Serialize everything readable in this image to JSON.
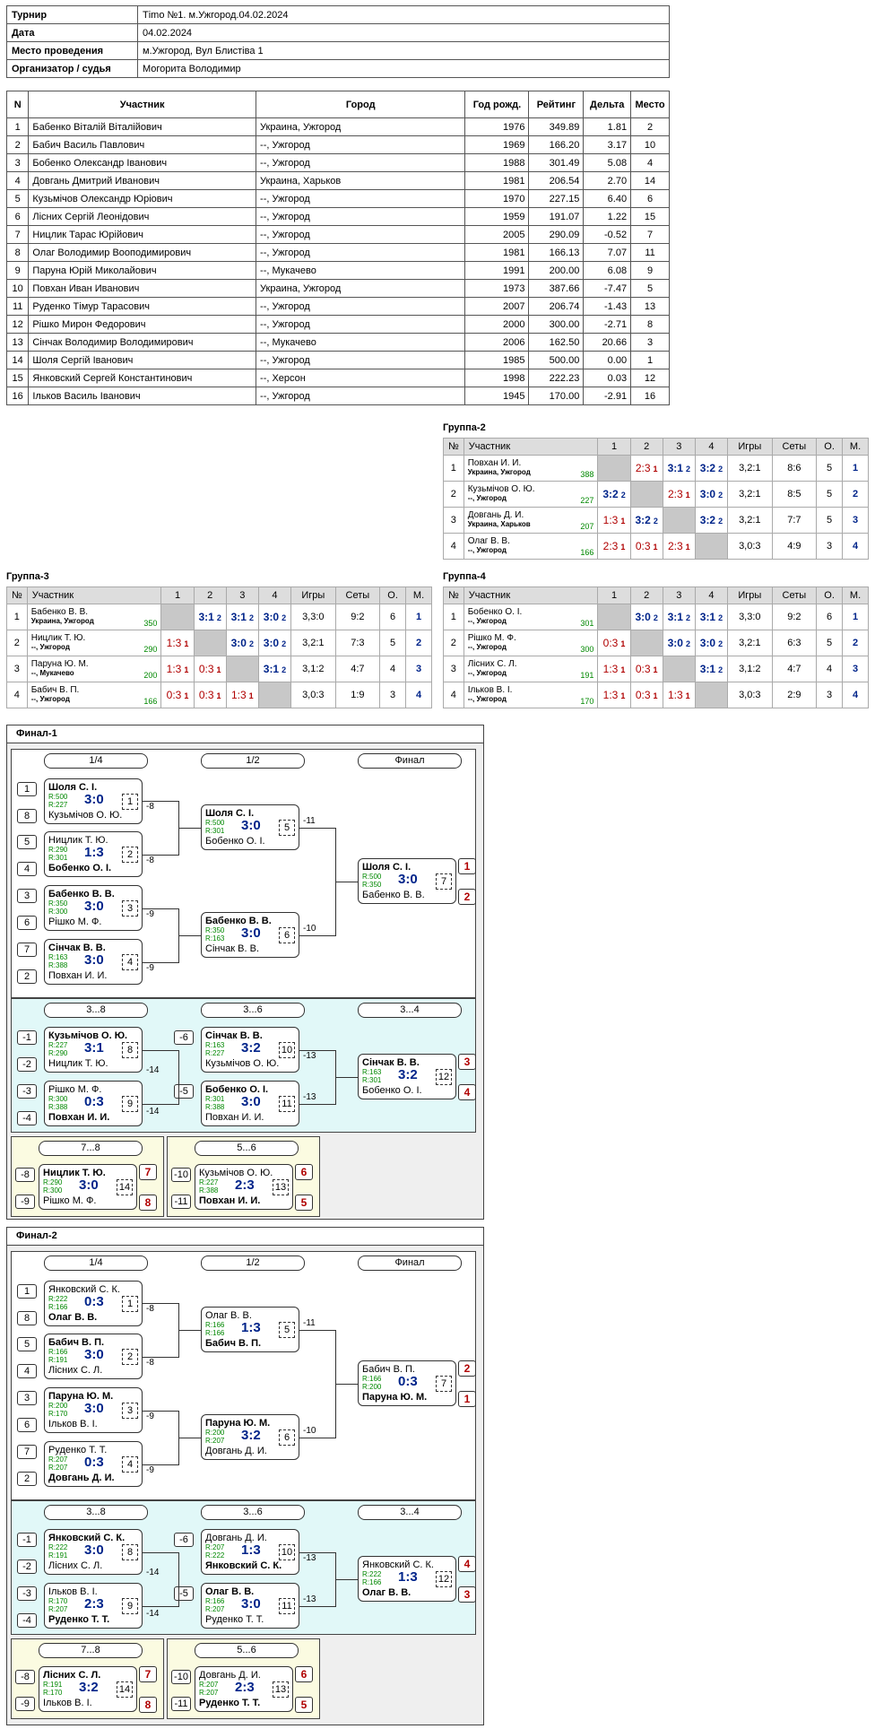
{
  "info": {
    "rows": [
      [
        "Турнир",
        "Тimo №1. м.Ужгород.04.02.2024"
      ],
      [
        "Дата",
        "04.02.2024"
      ],
      [
        "Место проведения",
        "м.Ужгород, Вул Блистіва 1"
      ],
      [
        "Организатор / судья",
        "Могорита Володимир"
      ]
    ]
  },
  "players": {
    "headers": [
      "N",
      "Участник",
      "Город",
      "Год рожд.",
      "Рейтинг",
      "Дельта",
      "Место"
    ],
    "rows": [
      [
        "1",
        "Бабенко Віталій Віталійович",
        "Украина, Ужгород",
        "1976",
        "349.89",
        "1.81",
        "2"
      ],
      [
        "2",
        "Бабич Василь Павлович",
        "--, Ужгород",
        "1969",
        "166.20",
        "3.17",
        "10"
      ],
      [
        "3",
        "Бобенко Олександр Іванович",
        "--, Ужгород",
        "1988",
        "301.49",
        "5.08",
        "4"
      ],
      [
        "4",
        "Довгань Дмитрий Иванович",
        "Украина, Харьков",
        "1981",
        "206.54",
        "2.70",
        "14"
      ],
      [
        "5",
        "Кузьмічов Олександр Юріович",
        "--, Ужгород",
        "1970",
        "227.15",
        "6.40",
        "6"
      ],
      [
        "6",
        "Лісних Сергій Леонідович",
        "--, Ужгород",
        "1959",
        "191.07",
        "1.22",
        "15"
      ],
      [
        "7",
        "Ницлик Тарас Юрійович",
        "--, Ужгород",
        "2005",
        "290.09",
        "-0.52",
        "7"
      ],
      [
        "8",
        "Олаг Володимир Вооподимирович",
        "--, Ужгород",
        "1981",
        "166.13",
        "7.07",
        "11"
      ],
      [
        "9",
        "Паруна Юрій Миколайович",
        "--, Мукачево",
        "1991",
        "200.00",
        "6.08",
        "9"
      ],
      [
        "10",
        "Повхан Иван Иванович",
        "Украина, Ужгород",
        "1973",
        "387.66",
        "-7.47",
        "5"
      ],
      [
        "11",
        "Руденко Тімур Тарасович",
        "--, Ужгород",
        "2007",
        "206.74",
        "-1.43",
        "13"
      ],
      [
        "12",
        "Рішко Мирон Федорович",
        "--, Ужгород",
        "2000",
        "300.00",
        "-2.71",
        "8"
      ],
      [
        "13",
        "Сінчак Володимир Володимирович",
        "--, Мукачево",
        "2006",
        "162.50",
        "20.66",
        "3"
      ],
      [
        "14",
        "Шоля Сергій Іванович",
        "--, Ужгород",
        "1985",
        "500.00",
        "0.00",
        "1"
      ],
      [
        "15",
        "Янковский Сергей Константинович",
        "--, Херсон",
        "1998",
        "222.23",
        "0.03",
        "12"
      ],
      [
        "16",
        "Ільков Василь Іванович",
        "--, Ужгород",
        "1945",
        "170.00",
        "-2.91",
        "16"
      ]
    ]
  },
  "group_headers": [
    "№",
    "Участник",
    "1",
    "2",
    "3",
    "4",
    "Игры",
    "Сеты",
    "О.",
    "М."
  ],
  "groups": [
    {
      "title": "Группа-2",
      "rows": [
        {
          "n": "1",
          "name": "Повхан И. И.",
          "city": "Украина, Ужгород",
          "rating": "388",
          "cells": [
            null,
            [
              "2:3",
              "1"
            ],
            [
              "3:1",
              "2"
            ],
            [
              "3:2",
              "2"
            ]
          ],
          "games": "3,2:1",
          "sets": "8:6",
          "pts": "5",
          "place": "1"
        },
        {
          "n": "2",
          "name": "Кузьмічов О. Ю.",
          "city": "--, Ужгород",
          "rating": "227",
          "cells": [
            [
              "3:2",
              "2"
            ],
            null,
            [
              "2:3",
              "1"
            ],
            [
              "3:0",
              "2"
            ]
          ],
          "games": "3,2:1",
          "sets": "8:5",
          "pts": "5",
          "place": "2"
        },
        {
          "n": "3",
          "name": "Довгань Д. И.",
          "city": "Украина, Харьков",
          "rating": "207",
          "cells": [
            [
              "1:3",
              "1"
            ],
            [
              "3:2",
              "2"
            ],
            null,
            [
              "3:2",
              "2"
            ]
          ],
          "games": "3,2:1",
          "sets": "7:7",
          "pts": "5",
          "place": "3"
        },
        {
          "n": "4",
          "name": "Олаг В. В.",
          "city": "--, Ужгород",
          "rating": "166",
          "cells": [
            [
              "2:3",
              "1"
            ],
            [
              "0:3",
              "1"
            ],
            [
              "2:3",
              "1"
            ],
            null
          ],
          "games": "3,0:3",
          "sets": "4:9",
          "pts": "3",
          "place": "4"
        }
      ]
    },
    {
      "title": "Группа-3",
      "rows": [
        {
          "n": "1",
          "name": "Бабенко В. В.",
          "city": "Украина, Ужгород",
          "rating": "350",
          "cells": [
            null,
            [
              "3:1",
              "2"
            ],
            [
              "3:1",
              "2"
            ],
            [
              "3:0",
              "2"
            ]
          ],
          "games": "3,3:0",
          "sets": "9:2",
          "pts": "6",
          "place": "1"
        },
        {
          "n": "2",
          "name": "Ницлик Т. Ю.",
          "city": "--, Ужгород",
          "rating": "290",
          "cells": [
            [
              "1:3",
              "1"
            ],
            null,
            [
              "3:0",
              "2"
            ],
            [
              "3:0",
              "2"
            ]
          ],
          "games": "3,2:1",
          "sets": "7:3",
          "pts": "5",
          "place": "2"
        },
        {
          "n": "3",
          "name": "Паруна Ю. М.",
          "city": "--, Мукачево",
          "rating": "200",
          "cells": [
            [
              "1:3",
              "1"
            ],
            [
              "0:3",
              "1"
            ],
            null,
            [
              "3:1",
              "2"
            ]
          ],
          "games": "3,1:2",
          "sets": "4:7",
          "pts": "4",
          "place": "3"
        },
        {
          "n": "4",
          "name": "Бабич В. П.",
          "city": "--, Ужгород",
          "rating": "166",
          "cells": [
            [
              "0:3",
              "1"
            ],
            [
              "0:3",
              "1"
            ],
            [
              "1:3",
              "1"
            ],
            null
          ],
          "games": "3,0:3",
          "sets": "1:9",
          "pts": "3",
          "place": "4"
        }
      ]
    },
    {
      "title": "Группа-4",
      "rows": [
        {
          "n": "1",
          "name": "Бобенко О. І.",
          "city": "--, Ужгород",
          "rating": "301",
          "cells": [
            null,
            [
              "3:0",
              "2"
            ],
            [
              "3:1",
              "2"
            ],
            [
              "3:1",
              "2"
            ]
          ],
          "games": "3,3:0",
          "sets": "9:2",
          "pts": "6",
          "place": "1"
        },
        {
          "n": "2",
          "name": "Рішко М. Ф.",
          "city": "--, Ужгород",
          "rating": "300",
          "cells": [
            [
              "0:3",
              "1"
            ],
            null,
            [
              "3:0",
              "2"
            ],
            [
              "3:0",
              "2"
            ]
          ],
          "games": "3,2:1",
          "sets": "6:3",
          "pts": "5",
          "place": "2"
        },
        {
          "n": "3",
          "name": "Лісних С. Л.",
          "city": "--, Ужгород",
          "rating": "191",
          "cells": [
            [
              "1:3",
              "1"
            ],
            [
              "0:3",
              "1"
            ],
            null,
            [
              "3:1",
              "2"
            ]
          ],
          "games": "3,1:2",
          "sets": "4:7",
          "pts": "4",
          "place": "3"
        },
        {
          "n": "4",
          "name": "Ільков В. І.",
          "city": "--, Ужгород",
          "rating": "170",
          "cells": [
            [
              "1:3",
              "1"
            ],
            [
              "0:3",
              "1"
            ],
            [
              "1:3",
              "1"
            ],
            null
          ],
          "games": "3,0:3",
          "sets": "2:9",
          "pts": "3",
          "place": "4"
        }
      ]
    }
  ],
  "finals": [
    {
      "title": "Финал-1",
      "rounds": [
        "1/4",
        "1/2",
        "Финал",
        "3...8",
        "3...6",
        "3...4",
        "7...8",
        "5...6"
      ],
      "seeds": [
        "1",
        "8",
        "5",
        "4",
        "3",
        "6",
        "7",
        "2",
        "-1",
        "-2",
        "-3",
        "-4",
        "-6",
        "-5",
        "-8",
        "-9",
        "-10",
        "-11"
      ],
      "results": [
        "1",
        "2",
        "3",
        "4",
        "7",
        "8",
        "6",
        "5"
      ],
      "links": [
        "-8",
        "-8",
        "-9",
        "-9",
        "-11",
        "-10",
        "-14",
        "-14",
        "-13",
        "-13"
      ],
      "matches": [
        {
          "p1": "Шоля С. І.",
          "r1": "R:500",
          "p2": "Кузьмічов О. Ю.",
          "r2": "R:227",
          "s": "3:0",
          "n": "1",
          "w": 1
        },
        {
          "p1": "Ницлик Т. Ю.",
          "r1": "R:290",
          "p2": "Бобенко О. І.",
          "r2": "R:301",
          "s": "1:3",
          "n": "2",
          "w": 2
        },
        {
          "p1": "Бабенко В. В.",
          "r1": "R:350",
          "p2": "Рішко М. Ф.",
          "r2": "R:300",
          "s": "3:0",
          "n": "3",
          "w": 1
        },
        {
          "p1": "Сінчак В. В.",
          "r1": "R:163",
          "p2": "Повхан И. И.",
          "r2": "R:388",
          "s": "3:0",
          "n": "4",
          "w": 1
        },
        {
          "p1": "Шоля С. І.",
          "r1": "R:500",
          "p2": "Бобенко О. І.",
          "r2": "R:301",
          "s": "3:0",
          "n": "5",
          "w": 1
        },
        {
          "p1": "Бабенко В. В.",
          "r1": "R:350",
          "p2": "Сінчак В. В.",
          "r2": "R:163",
          "s": "3:0",
          "n": "6",
          "w": 1
        },
        {
          "p1": "Шоля С. І.",
          "r1": "R:500",
          "p2": "Бабенко В. В.",
          "r2": "R:350",
          "s": "3:0",
          "n": "7",
          "w": 1
        },
        {
          "p1": "Кузьмічов О. Ю.",
          "r1": "R:227",
          "p2": "Ницлик Т. Ю.",
          "r2": "R:290",
          "s": "3:1",
          "n": "8",
          "w": 1
        },
        {
          "p1": "Рішко М. Ф.",
          "r1": "R:300",
          "p2": "Повхан И. И.",
          "r2": "R:388",
          "s": "0:3",
          "n": "9",
          "w": 2
        },
        {
          "p1": "Сінчак В. В.",
          "r1": "R:163",
          "p2": "Кузьмічов О. Ю.",
          "r2": "R:227",
          "s": "3:2",
          "n": "10",
          "w": 1
        },
        {
          "p1": "Бобенко О. І.",
          "r1": "R:301",
          "p2": "Повхан И. И.",
          "r2": "R:388",
          "s": "3:0",
          "n": "11",
          "w": 1
        },
        {
          "p1": "Сінчак В. В.",
          "r1": "R:163",
          "p2": "Бобенко О. І.",
          "r2": "R:301",
          "s": "3:2",
          "n": "12",
          "w": 1
        },
        {
          "p1": "Ницлик Т. Ю.",
          "r1": "R:290",
          "p2": "Рішко М. Ф.",
          "r2": "R:300",
          "s": "3:0",
          "n": "14",
          "w": 1
        },
        {
          "p1": "Кузьмічов О. Ю.",
          "r1": "R:227",
          "p2": "Повхан И. И.",
          "r2": "R:388",
          "s": "2:3",
          "n": "13",
          "w": 2
        }
      ]
    },
    {
      "title": "Финал-2",
      "rounds": [
        "1/4",
        "1/2",
        "Финал",
        "3...8",
        "3...6",
        "3...4",
        "7...8",
        "5...6"
      ],
      "seeds": [
        "1",
        "8",
        "5",
        "4",
        "3",
        "6",
        "7",
        "2",
        "-1",
        "-2",
        "-3",
        "-4",
        "-6",
        "-5",
        "-8",
        "-9",
        "-10",
        "-11"
      ],
      "results": [
        "2",
        "1",
        "4",
        "3",
        "7",
        "8",
        "6",
        "5"
      ],
      "links": [
        "-8",
        "-8",
        "-9",
        "-9",
        "-11",
        "-10",
        "-14",
        "-14",
        "-13",
        "-13"
      ],
      "matches": [
        {
          "p1": "Янковский С. К.",
          "r1": "R:222",
          "p2": "Олаг В. В.",
          "r2": "R:166",
          "s": "0:3",
          "n": "1",
          "w": 2
        },
        {
          "p1": "Бабич В. П.",
          "r1": "R:166",
          "p2": "Лісних С. Л.",
          "r2": "R:191",
          "s": "3:0",
          "n": "2",
          "w": 1
        },
        {
          "p1": "Паруна Ю. М.",
          "r1": "R:200",
          "p2": "Ільков В. І.",
          "r2": "R:170",
          "s": "3:0",
          "n": "3",
          "w": 1
        },
        {
          "p1": "Руденко Т. Т.",
          "r1": "R:207",
          "p2": "Довгань Д. И.",
          "r2": "R:207",
          "s": "0:3",
          "n": "4",
          "w": 2
        },
        {
          "p1": "Олаг В. В.",
          "r1": "R:166",
          "p2": "Бабич В. П.",
          "r2": "R:166",
          "s": "1:3",
          "n": "5",
          "w": 2
        },
        {
          "p1": "Паруна Ю. М.",
          "r1": "R:200",
          "p2": "Довгань Д. И.",
          "r2": "R:207",
          "s": "3:2",
          "n": "6",
          "w": 1
        },
        {
          "p1": "Бабич В. П.",
          "r1": "R:166",
          "p2": "Паруна Ю. М.",
          "r2": "R:200",
          "s": "0:3",
          "n": "7",
          "w": 2
        },
        {
          "p1": "Янковский С. К.",
          "r1": "R:222",
          "p2": "Лісних С. Л.",
          "r2": "R:191",
          "s": "3:0",
          "n": "8",
          "w": 1
        },
        {
          "p1": "Ільков В. І.",
          "r1": "R:170",
          "p2": "Руденко Т. Т.",
          "r2": "R:207",
          "s": "2:3",
          "n": "9",
          "w": 2
        },
        {
          "p1": "Довгань Д. И.",
          "r1": "R:207",
          "p2": "Янковский С. К.",
          "r2": "R:222",
          "s": "1:3",
          "n": "10",
          "w": 2
        },
        {
          "p1": "Олаг В. В.",
          "r1": "R:166",
          "p2": "Руденко Т. Т.",
          "r2": "R:207",
          "s": "3:0",
          "n": "11",
          "w": 1
        },
        {
          "p1": "Янковский С. К.",
          "r1": "R:222",
          "p2": "Олаг В. В.",
          "r2": "R:166",
          "s": "1:3",
          "n": "12",
          "w": 2
        },
        {
          "p1": "Лісних С. Л.",
          "r1": "R:191",
          "p2": "Ільков В. І.",
          "r2": "R:170",
          "s": "3:2",
          "n": "14",
          "w": 1
        },
        {
          "p1": "Довгань Д. И.",
          "r1": "R:207",
          "p2": "Руденко Т. Т.",
          "r2": "R:207",
          "s": "2:3",
          "n": "13",
          "w": 2
        }
      ]
    }
  ]
}
